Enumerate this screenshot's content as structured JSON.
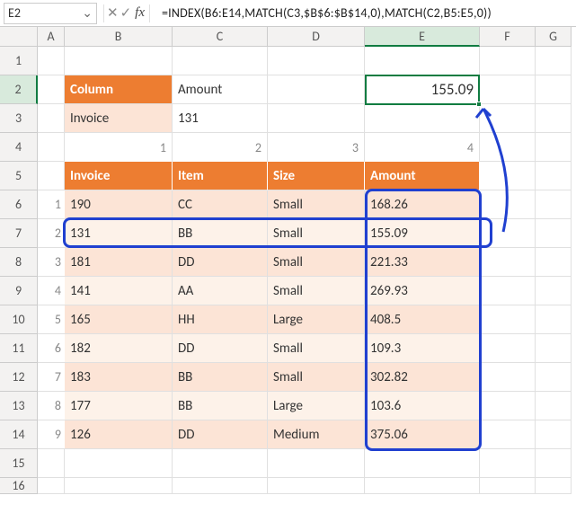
{
  "nameBox": {
    "value": "E2"
  },
  "formulaBar": {
    "formula": "=INDEX(B6:E14,MATCH(C3,$B$6:$B$14,0),MATCH(C2,B5:E5,0))"
  },
  "columns": [
    "A",
    "B",
    "C",
    "D",
    "E",
    "F",
    "G"
  ],
  "activeColumn": "E",
  "activeRow": 2,
  "result": "155.09",
  "lookup": {
    "columnLabel": "Column",
    "columnValue": "Amount",
    "invoiceLabel": "Invoice",
    "invoiceValue": "131"
  },
  "topIndices": [
    "1",
    "2",
    "3",
    "4"
  ],
  "leftIndices": [
    "1",
    "2",
    "3",
    "4",
    "5",
    "6",
    "7",
    "8",
    "9"
  ],
  "headers": [
    "Invoice",
    "Item",
    "Size",
    "Amount"
  ],
  "rows": [
    {
      "invoice": "190",
      "item": "CC",
      "size": "Small",
      "amount": "168.26"
    },
    {
      "invoice": "131",
      "item": "BB",
      "size": "Small",
      "amount": "155.09"
    },
    {
      "invoice": "181",
      "item": "DD",
      "size": "Small",
      "amount": "221.33"
    },
    {
      "invoice": "141",
      "item": "AA",
      "size": "Small",
      "amount": "269.93"
    },
    {
      "invoice": "165",
      "item": "HH",
      "size": "Large",
      "amount": "408.5"
    },
    {
      "invoice": "182",
      "item": "DD",
      "size": "Small",
      "amount": "109.3"
    },
    {
      "invoice": "183",
      "item": "BB",
      "size": "Small",
      "amount": "302.82"
    },
    {
      "invoice": "177",
      "item": "BB",
      "size": "Large",
      "amount": "103.6"
    },
    {
      "invoice": "126",
      "item": "DD",
      "size": "Medium",
      "amount": "375.06"
    }
  ],
  "rowNumbers": [
    "1",
    "2",
    "3",
    "4",
    "5",
    "6",
    "7",
    "8",
    "9",
    "10",
    "11",
    "12",
    "13",
    "14",
    "15",
    "16"
  ],
  "chart_data": {
    "type": "table",
    "title": "INDEX/MATCH lookup",
    "columns": [
      "Invoice",
      "Item",
      "Size",
      "Amount"
    ],
    "data": [
      [
        190,
        "CC",
        "Small",
        168.26
      ],
      [
        131,
        "BB",
        "Small",
        155.09
      ],
      [
        181,
        "DD",
        "Small",
        221.33
      ],
      [
        141,
        "AA",
        "Small",
        269.93
      ],
      [
        165,
        "HH",
        "Large",
        408.5
      ],
      [
        182,
        "DD",
        "Small",
        109.3
      ],
      [
        183,
        "BB",
        "Small",
        302.82
      ],
      [
        177,
        "BB",
        "Large",
        103.6
      ],
      [
        126,
        "DD",
        "Medium",
        375.06
      ]
    ],
    "lookup_column": "Amount",
    "lookup_invoice": 131,
    "result": 155.09
  }
}
